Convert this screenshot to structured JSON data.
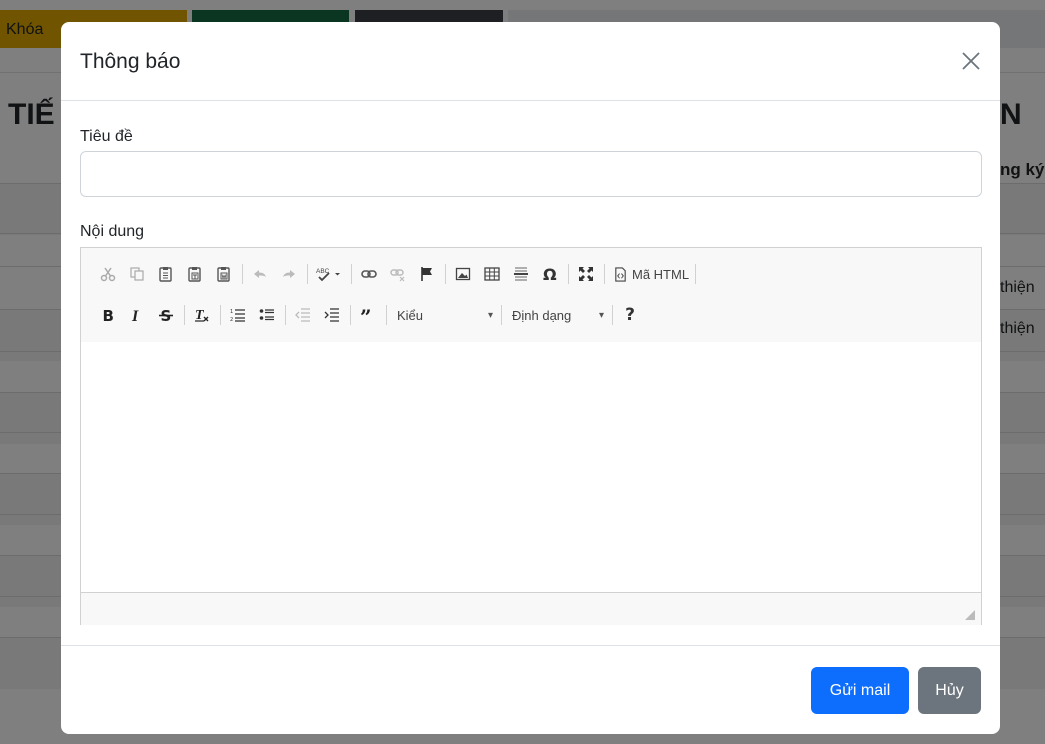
{
  "background": {
    "tabs": [
      {
        "label": "Khóa"
      },
      {
        "label": ""
      },
      {
        "label": ""
      },
      {
        "label": ""
      }
    ],
    "title_left": "TIẾ",
    "title_right": "N",
    "column_header": "ng ký",
    "rows": [
      "",
      "",
      "thiện",
      "thiện",
      "",
      "",
      "",
      "",
      "",
      "",
      ""
    ]
  },
  "modal": {
    "title": "Thông báo",
    "close_icon": "close-x-icon",
    "form": {
      "title_label": "Tiêu đề",
      "title_value": "",
      "content_label": "Nội dung"
    },
    "editor": {
      "row1_icons": [
        "cut-icon",
        "copy-icon",
        "paste-icon",
        "paste-text-icon",
        "paste-word-icon",
        "undo-icon",
        "redo-icon",
        "spellcheck-icon",
        "link-icon",
        "unlink-icon",
        "anchor-icon",
        "image-icon",
        "table-icon",
        "horizontal-line-icon",
        "special-char-icon",
        "maximize-icon",
        "source-icon"
      ],
      "source_label": "Mã HTML",
      "row2_icons": [
        "bold-icon",
        "italic-icon",
        "strikethrough-icon",
        "remove-format-icon",
        "numbered-list-icon",
        "bulleted-list-icon",
        "outdent-icon",
        "indent-icon",
        "blockquote-icon",
        "help-icon"
      ],
      "styles_combo": "Kiểu",
      "format_combo": "Định dạng",
      "content": ""
    },
    "footer": {
      "send_label": "Gửi mail",
      "cancel_label": "Hủy"
    }
  },
  "colors": {
    "primary": "#0d6efd",
    "secondary": "#6c757d",
    "tab_warning": "#e0a800",
    "tab_success": "#146c43",
    "tab_dark": "#3a3f44"
  }
}
